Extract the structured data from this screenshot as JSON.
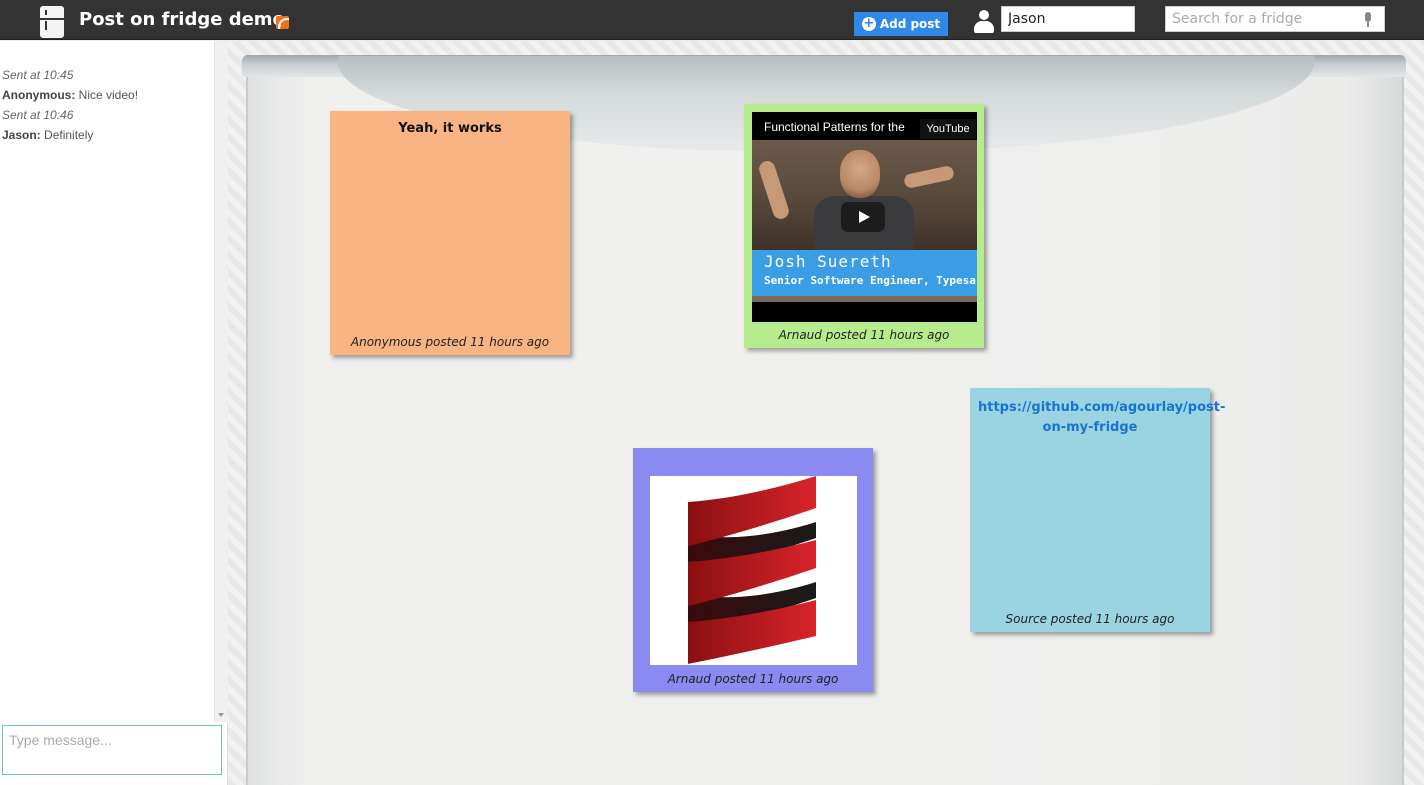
{
  "header": {
    "app_title": "Post on fridge demo",
    "add_post_label": "Add post",
    "username_value": "Jason",
    "search_placeholder": "Search for a fridge"
  },
  "chat": {
    "messages": [
      {
        "type": "time",
        "text": "Sent at 10:45"
      },
      {
        "type": "message",
        "author": "Anonymous:",
        "text": " Nice video!"
      },
      {
        "type": "time",
        "text": "Sent at 10:46"
      },
      {
        "type": "message",
        "author": "Jason:",
        "text": " Definitely"
      }
    ],
    "input_placeholder": "Type message..."
  },
  "notes": [
    {
      "id": "note-text",
      "color": "#f8b483",
      "title": "Yeah, it works",
      "footer": "Anonymous posted 11 hours ago"
    },
    {
      "id": "note-video",
      "color": "#b6ec8e",
      "video": {
        "title": "Functional Patterns for the",
        "badge": "YouTube",
        "speaker_name": "Josh Suereth",
        "speaker_role": "Senior Software Engineer, Typesa"
      },
      "footer": "Arnaud posted 11 hours ago"
    },
    {
      "id": "note-image",
      "color": "#8a8af0",
      "image": "scala-logo",
      "footer": "Arnaud posted 11 hours ago"
    },
    {
      "id": "note-link",
      "color": "#9ad4e0",
      "link": "https://github.com/agourlay/post-on-my-fridge",
      "footer": "Source posted 11 hours ago"
    }
  ],
  "icons": {
    "logo": "fridge-icon",
    "feed": "rss-icon",
    "add": "plus-circle-icon",
    "user": "user-icon",
    "voice": "microphone-icon",
    "play": "play-icon"
  }
}
